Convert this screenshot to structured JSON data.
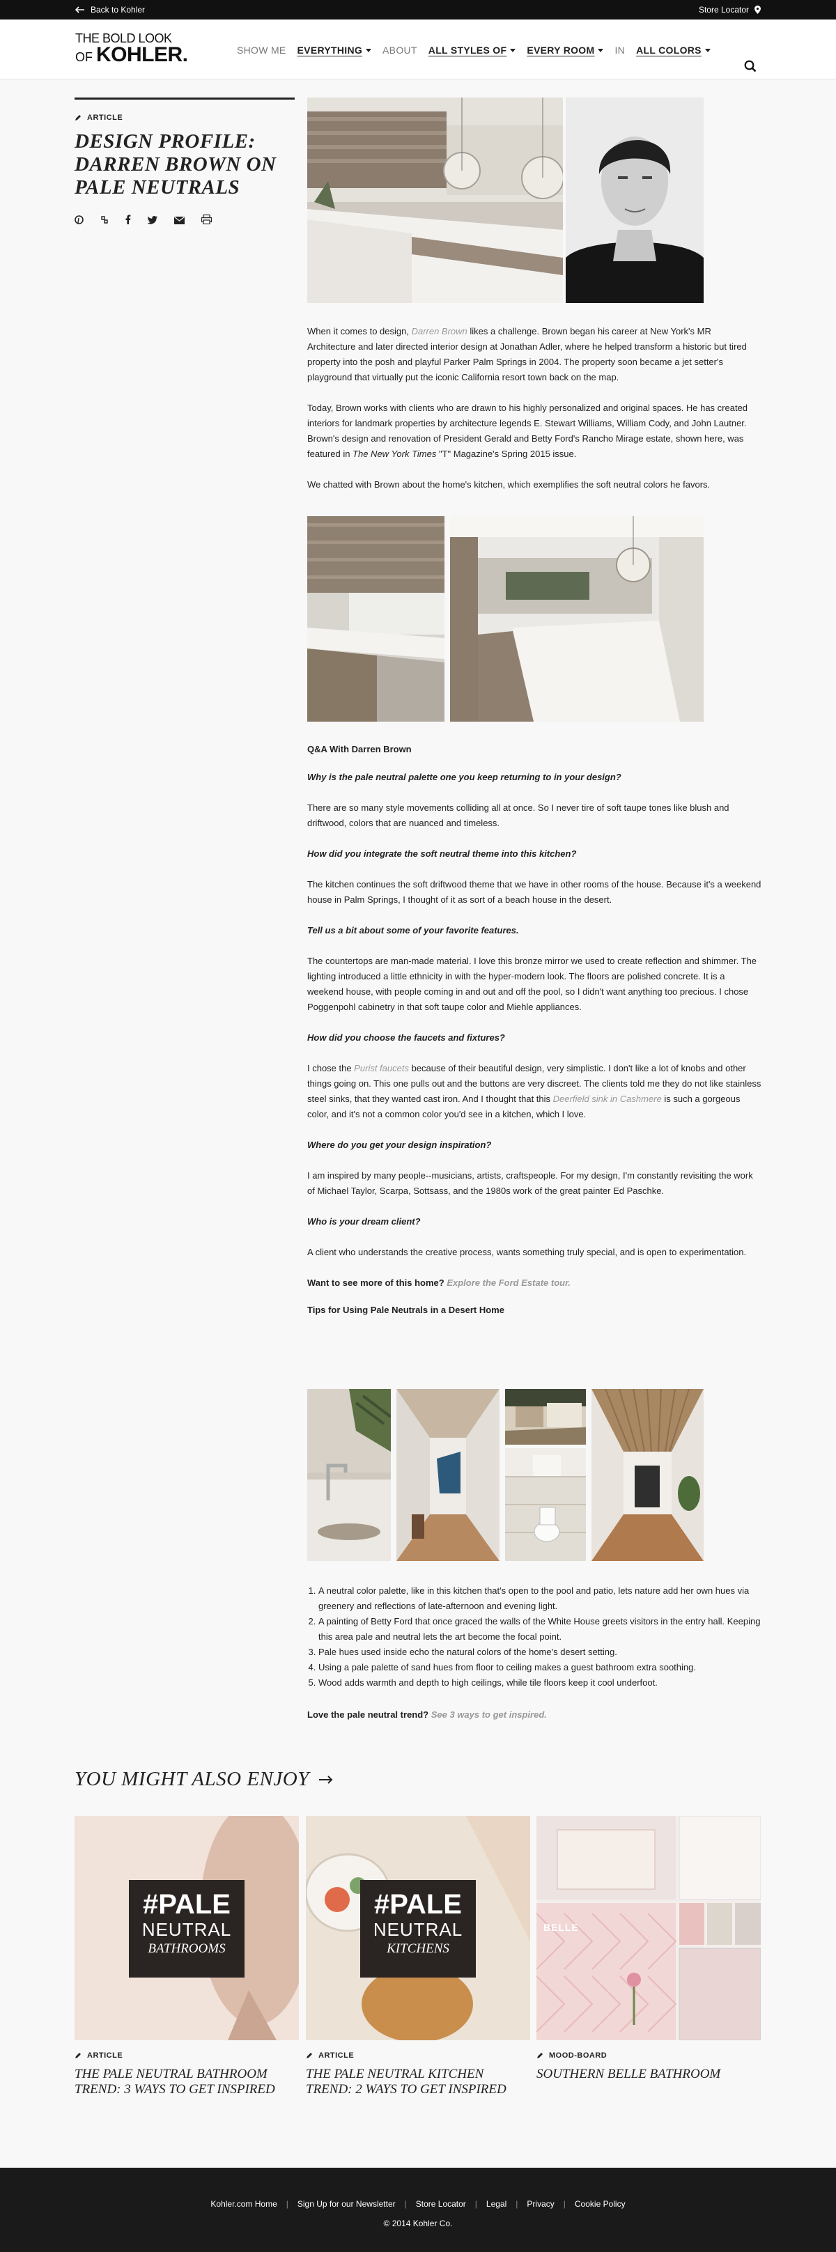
{
  "topbar": {
    "back_label": "Back to Kohler",
    "store_label": "Store Locator"
  },
  "header": {
    "logo_line1": "THE BOLD LOOK",
    "logo_of": "OF",
    "logo_brand": "KOHLER.",
    "show_me": "SHOW ME",
    "everything": "EVERYTHING",
    "about": "ABOUT",
    "all_styles": "ALL STYLES OF",
    "every_room": "EVERY ROOM",
    "in": "IN",
    "all_colors": "ALL COLORS"
  },
  "article": {
    "tag": "ARTICLE",
    "title": "DESIGN PROFILE: DARREN BROWN ON PALE NEUTRALS",
    "p1_a": "When it comes to design, ",
    "p1_link": "Darren Brown",
    "p1_b": " likes a challenge. Brown began his career at New York's MR Architecture and later directed interior design at Jonathan Adler, where he helped transform a historic but tired property into the posh and playful Parker Palm Springs in 2004. The property soon became a jet setter's playground that virtually put the iconic California resort town back on the map.",
    "p2_a": "Today, Brown works with clients who are drawn to his highly personalized and original spaces. He has created interiors for landmark properties by architecture legends E. Stewart Williams, William Cody, and John Lautner. Brown's design and renovation of President Gerald and Betty Ford's Rancho Mirage estate, shown here, was featured in ",
    "p2_em": "The New York Times",
    "p2_b": " \"T\" Magazine's Spring 2015 issue.",
    "p3": "We chatted with Brown about the home's kitchen, which exemplifies the soft neutral colors he favors.",
    "qa_heading": "Q&A With Darren Brown",
    "q1": "Why is the pale neutral palette one you keep returning to in your design?",
    "a1": "There are so many style movements colliding all at once. So I never tire of soft taupe tones like blush and driftwood, colors that are nuanced and timeless.",
    "q2": "How did you integrate the soft neutral theme into this kitchen?",
    "a2": "The kitchen continues the soft driftwood theme that we have in other rooms of the house. Because it's a weekend house in Palm Springs, I thought of it as sort of a beach house in the desert.",
    "q3": "Tell us a bit about some of your favorite features.",
    "a3": "The countertops are man-made material. I love this bronze mirror we used to create reflection and shimmer. The lighting introduced a little ethnicity in with the hyper-modern look. The floors are polished concrete. It is a weekend house, with people coming in and out and off the pool, so I didn't want anything too precious. I chose Poggenpohl cabinetry in that soft taupe color and Miehle appliances.",
    "q4": "How did you choose the faucets and fixtures?",
    "a4_a": "I chose the ",
    "a4_link1": "Purist faucets",
    "a4_b": " because of their beautiful design, very simplistic. I don't like a lot of knobs and other things going on. This one pulls out and the buttons are very discreet. The clients told me they do not like stainless steel sinks, that they wanted cast iron. And I thought that this ",
    "a4_link2": "Deerfield sink in Cashmere",
    "a4_c": " is such a gorgeous color, and it's not a common color you'd see in a kitchen, which I love.",
    "q5": "Where do you get your design inspiration?",
    "a5": "I am inspired by many people--musicians, artists, craftspeople. For my design, I'm constantly revisiting the work of Michael Taylor, Scarpa, Sottsass, and the 1980s work of the great painter Ed Paschke.",
    "q6": "Who is your dream client?",
    "a6": "A client who understands the creative process, wants something truly special, and is open to experimentation.",
    "more_label": "Want to see more of this home?",
    "more_link": "Explore the Ford Estate tour.",
    "tips_heading": "Tips for Using Pale Neutrals in a Desert Home",
    "tips": [
      "A neutral color palette, like in this kitchen that's open to the pool and patio, lets nature add her own hues via greenery and reflections of late-afternoon and evening light.",
      "A painting of Betty Ford that once graced the walls of the White House greets visitors in the entry hall. Keeping this area pale and neutral lets the art become the focal point.",
      "Pale hues used inside echo the natural colors of the home's desert setting.",
      "Using a pale palette of sand hues from floor to ceiling makes a guest bathroom extra soothing.",
      "Wood adds warmth and depth to high ceilings, while tile floors keep it cool underfoot."
    ],
    "love_label": "Love the pale neutral trend?",
    "love_link": "See 3 ways to get inspired."
  },
  "ymae": {
    "title": "YOU MIGHT ALSO ENJOY",
    "cards": [
      {
        "tag": "ARTICLE",
        "title": "THE PALE NEUTRAL BATHROOM TREND: 3 WAYS TO GET INSPIRED",
        "big": "#PALE",
        "mid": "NEUTRAL",
        "small": "BATHROOMS"
      },
      {
        "tag": "ARTICLE",
        "title": "THE PALE NEUTRAL KITCHEN TREND: 2 WAYS TO GET INSPIRED",
        "big": "#PALE",
        "mid": "NEUTRAL",
        "small": "KITCHENS"
      },
      {
        "tag": "MOOD-BOARD",
        "title": "SOUTHERN BELLE BATHROOM",
        "badge": "BELLE"
      }
    ]
  },
  "footer": {
    "links": [
      "Kohler.com Home",
      "Sign Up for our Newsletter",
      "Store Locator",
      "Legal",
      "Privacy",
      "Cookie Policy"
    ],
    "copyright": "© 2014 Kohler Co."
  }
}
